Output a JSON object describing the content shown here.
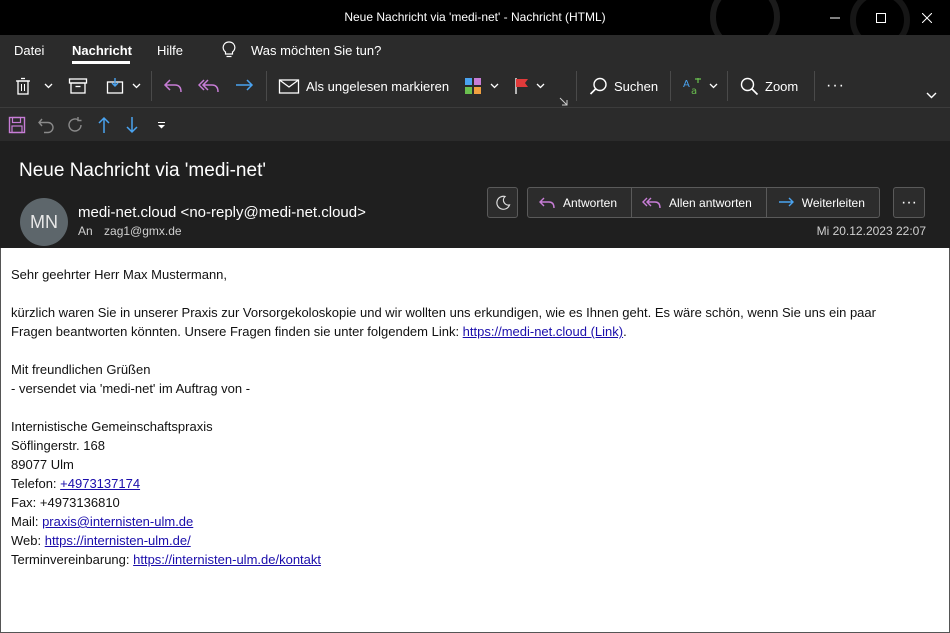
{
  "window": {
    "title": "Neue Nachricht via 'medi-net'  -  Nachricht (HTML)"
  },
  "menu": {
    "file": "Datei",
    "message": "Nachricht",
    "help": "Hilfe",
    "tell_me": "Was möchten Sie tun?"
  },
  "ribbon": {
    "mark_unread": "Als ungelesen markieren",
    "search": "Suchen",
    "zoom": "Zoom",
    "more": "···"
  },
  "header": {
    "subject": "Neue Nachricht via 'medi-net'",
    "avatar_initials": "MN",
    "sender": "medi-net.cloud <no-reply@medi-net.cloud>",
    "to_label": "An",
    "to_value": "zag1@gmx.de",
    "reply": "Antworten",
    "reply_all": "Allen antworten",
    "forward": "Weiterleiten",
    "more": "···",
    "date": "Mi 20.12.2023 22:07"
  },
  "body": {
    "greeting": "Sehr geehrter Herr Max Mustermann,",
    "para1": "kürzlich waren Sie in unserer Praxis zur Vorsorgekoloskopie und wir wollten uns erkundigen, wie es Ihnen geht. Es wäre schön, wenn Sie uns ein paar Fragen beantworten könnten. Unsere Fragen finden sie unter folgendem Link: ",
    "para1_link": "https://medi-net.cloud (Link)",
    "para1_end": ".",
    "closing": "Mit freundlichen Grüßen",
    "sent_via": "- versendet via 'medi-net' im Auftrag von -",
    "org": "Internistische Gemeinschaftspraxis",
    "street": "Söflingerstr. 168",
    "city": "89077 Ulm",
    "phone_label": "Telefon: ",
    "phone": "+4973137174",
    "fax": "Fax: +4973136810",
    "mail_label": "Mail: ",
    "mail": "praxis@internisten-ulm.de",
    "web_label": "Web: ",
    "web": "https://internisten-ulm.de/",
    "appt_label": "Terminvereinbarung: ",
    "appt": "https://internisten-ulm.de/kontakt"
  },
  "colors": {
    "titlebar": "#000000",
    "ribbon": "#2b2b2b",
    "header": "#1f1f1f",
    "link": "#1a0dab",
    "reply_accent": "#c77dd6",
    "forward_accent": "#4aa3f0"
  }
}
